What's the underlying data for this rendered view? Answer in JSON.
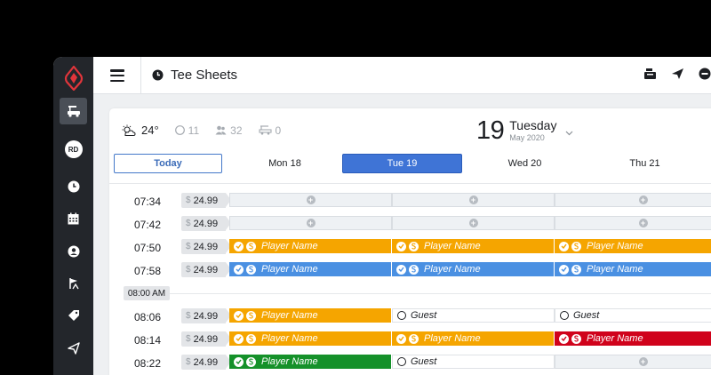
{
  "app": {
    "title": "Tee Sheets",
    "brand_color": "#e1353b"
  },
  "sidebar": {
    "items": [
      {
        "name": "tee-sheet",
        "icon": "golf-cart-icon",
        "active": true
      },
      {
        "name": "profile",
        "icon": "avatar-icon",
        "label": "RD"
      },
      {
        "name": "clock",
        "icon": "clock-icon"
      },
      {
        "name": "calendar",
        "icon": "calendar-icon"
      },
      {
        "name": "customers",
        "icon": "user-circle-icon"
      },
      {
        "name": "reports",
        "icon": "flag-icon"
      },
      {
        "name": "tags",
        "icon": "tag-icon"
      },
      {
        "name": "send",
        "icon": "paper-plane-icon"
      }
    ]
  },
  "header": {
    "title": "Tee Sheets",
    "actions": [
      "register-icon",
      "paper-plane-icon",
      "minus-circle-icon"
    ]
  },
  "weather": {
    "icon": "partly-sunny-icon",
    "temp": "24°",
    "players": "11",
    "golfers": "32",
    "carts": "0"
  },
  "date": {
    "day_num": "19",
    "weekday": "Tuesday",
    "month_year": "May 2020"
  },
  "days": {
    "today": "Today",
    "mon": "Mon 18",
    "tue": "Tue 19",
    "wed": "Wed 20",
    "thu": "Thu 21"
  },
  "colors": {
    "orange": "#f5a500",
    "blue": "#4a90e2",
    "red": "#d0021b",
    "green": "#15912a",
    "selected_day": "#3f74d6"
  },
  "marker_label": "08:00 AM",
  "rows": [
    {
      "time": "07:34",
      "price": "24.99"
    },
    {
      "time": "07:42",
      "price": "24.99"
    },
    {
      "time": "07:50",
      "price": "24.99",
      "slots": [
        "Player Name",
        "Player Name",
        "Player Name"
      ]
    },
    {
      "time": "07:58",
      "price": "24.99",
      "slots": [
        "Player Name",
        "Player Name",
        "Player Name"
      ]
    },
    {
      "time": "08:06",
      "price": "24.99",
      "slots": [
        "Player Name",
        "Guest",
        "Guest"
      ]
    },
    {
      "time": "08:14",
      "price": "24.99",
      "slots": [
        "Player Name",
        "Player Name",
        "Player Name"
      ]
    },
    {
      "time": "08:22",
      "price": "24.99",
      "slots": [
        "Player Name",
        "Guest"
      ]
    }
  ],
  "currency": "$"
}
